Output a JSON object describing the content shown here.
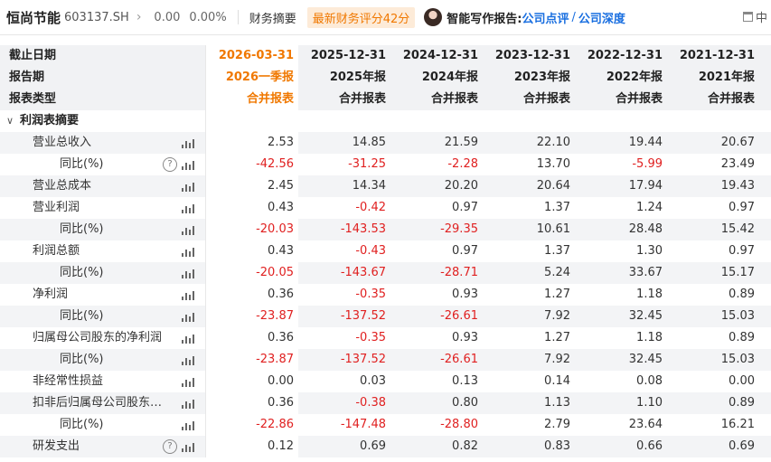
{
  "header": {
    "stock_name": "恒尚节能",
    "stock_code": "603137.SH",
    "price": "0.00",
    "change_pct": "0.00%",
    "tab": "财务摘要",
    "score_badge": "最新财务评分42分",
    "ai_label": "智能写作报告:",
    "link1": "公司点评",
    "link_sep": "/",
    "link2": "公司深度",
    "right_text": "中"
  },
  "rows_head": [
    {
      "label": "截止日期",
      "values": [
        "2026-03-31",
        "2025-12-31",
        "2024-12-31",
        "2023-12-31",
        "2022-12-31",
        "2021-12-31"
      ]
    },
    {
      "label": "报告期",
      "values": [
        "2026一季报",
        "2025年报",
        "2024年报",
        "2023年报",
        "2022年报",
        "2021年报"
      ]
    },
    {
      "label": "报表类型",
      "values": [
        "合并报表",
        "合并报表",
        "合并报表",
        "合并报表",
        "合并报表",
        "合并报表"
      ]
    }
  ],
  "section": {
    "label": "利润表摘要"
  },
  "rows": [
    {
      "label": "营业总收入",
      "indent": "mid",
      "help": false,
      "values": [
        "2.53",
        "14.85",
        "21.59",
        "22.10",
        "19.44",
        "20.67"
      ]
    },
    {
      "label": "同比(%)",
      "indent": "sub",
      "help": true,
      "values": [
        "-42.56",
        "-31.25",
        "-2.28",
        "13.70",
        "-5.99",
        "23.49"
      ]
    },
    {
      "label": "营业总成本",
      "indent": "mid",
      "help": false,
      "values": [
        "2.45",
        "14.34",
        "20.20",
        "20.64",
        "17.94",
        "19.43"
      ]
    },
    {
      "label": "营业利润",
      "indent": "mid",
      "help": false,
      "values": [
        "0.43",
        "-0.42",
        "0.97",
        "1.37",
        "1.24",
        "0.97"
      ]
    },
    {
      "label": "同比(%)",
      "indent": "sub",
      "help": false,
      "values": [
        "-20.03",
        "-143.53",
        "-29.35",
        "10.61",
        "28.48",
        "15.42"
      ]
    },
    {
      "label": "利润总额",
      "indent": "mid",
      "help": false,
      "values": [
        "0.43",
        "-0.43",
        "0.97",
        "1.37",
        "1.30",
        "0.97"
      ]
    },
    {
      "label": "同比(%)",
      "indent": "sub",
      "help": false,
      "values": [
        "-20.05",
        "-143.67",
        "-28.71",
        "5.24",
        "33.67",
        "15.17"
      ]
    },
    {
      "label": "净利润",
      "indent": "mid",
      "help": false,
      "values": [
        "0.36",
        "-0.35",
        "0.93",
        "1.27",
        "1.18",
        "0.89"
      ]
    },
    {
      "label": "同比(%)",
      "indent": "sub",
      "help": false,
      "values": [
        "-23.87",
        "-137.52",
        "-26.61",
        "7.92",
        "32.45",
        "15.03"
      ]
    },
    {
      "label": "归属母公司股东的净利润",
      "indent": "mid",
      "help": false,
      "values": [
        "0.36",
        "-0.35",
        "0.93",
        "1.27",
        "1.18",
        "0.89"
      ]
    },
    {
      "label": "同比(%)",
      "indent": "sub",
      "help": false,
      "values": [
        "-23.87",
        "-137.52",
        "-26.61",
        "7.92",
        "32.45",
        "15.03"
      ]
    },
    {
      "label": "非经常性损益",
      "indent": "mid",
      "help": false,
      "values": [
        "0.00",
        "0.03",
        "0.13",
        "0.14",
        "0.08",
        "0.00"
      ]
    },
    {
      "label": "扣非后归属母公司股东…",
      "indent": "mid",
      "help": false,
      "values": [
        "0.36",
        "-0.38",
        "0.80",
        "1.13",
        "1.10",
        "0.89"
      ]
    },
    {
      "label": "同比(%)",
      "indent": "sub",
      "help": false,
      "values": [
        "-22.86",
        "-147.48",
        "-28.80",
        "2.79",
        "23.64",
        "16.21"
      ]
    },
    {
      "label": "研发支出",
      "indent": "mid",
      "help": true,
      "values": [
        "0.12",
        "0.69",
        "0.82",
        "0.83",
        "0.66",
        "0.69"
      ]
    }
  ],
  "colors": {
    "accent": "#f07800",
    "negative": "#e02020",
    "link": "#1a6fe0",
    "alt_row": "#f3f4f6"
  }
}
